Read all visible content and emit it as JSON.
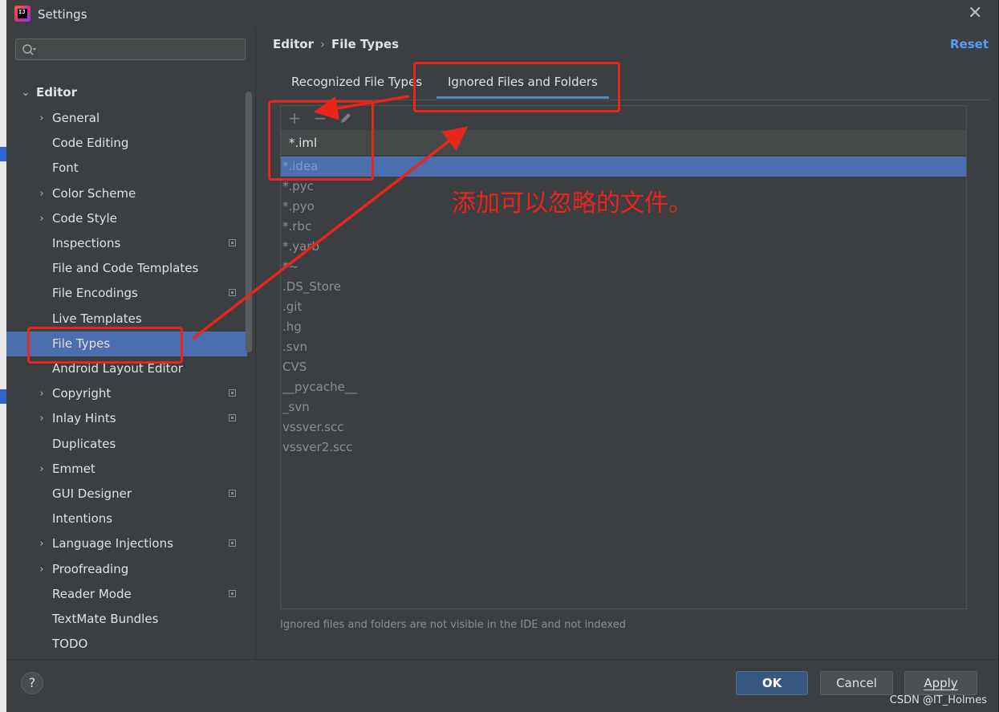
{
  "window": {
    "title": "Settings",
    "app_icon_text": "IJ"
  },
  "search": {
    "placeholder": "",
    "value": ""
  },
  "sidebar": {
    "section": {
      "label": "Editor",
      "expanded": true
    },
    "items": [
      {
        "label": "General",
        "has_children": true,
        "project_icon": false
      },
      {
        "label": "Code Editing",
        "has_children": false,
        "project_icon": false
      },
      {
        "label": "Font",
        "has_children": false,
        "project_icon": false
      },
      {
        "label": "Color Scheme",
        "has_children": true,
        "project_icon": false
      },
      {
        "label": "Code Style",
        "has_children": true,
        "project_icon": false
      },
      {
        "label": "Inspections",
        "has_children": false,
        "project_icon": true
      },
      {
        "label": "File and Code Templates",
        "has_children": false,
        "project_icon": false
      },
      {
        "label": "File Encodings",
        "has_children": false,
        "project_icon": true
      },
      {
        "label": "Live Templates",
        "has_children": false,
        "project_icon": false
      },
      {
        "label": "File Types",
        "has_children": false,
        "project_icon": false,
        "selected": true
      },
      {
        "label": "Android Layout Editor",
        "has_children": false,
        "project_icon": false
      },
      {
        "label": "Copyright",
        "has_children": true,
        "project_icon": true
      },
      {
        "label": "Inlay Hints",
        "has_children": true,
        "project_icon": true
      },
      {
        "label": "Duplicates",
        "has_children": false,
        "project_icon": false
      },
      {
        "label": "Emmet",
        "has_children": true,
        "project_icon": false
      },
      {
        "label": "GUI Designer",
        "has_children": false,
        "project_icon": true
      },
      {
        "label": "Intentions",
        "has_children": false,
        "project_icon": false
      },
      {
        "label": "Language Injections",
        "has_children": true,
        "project_icon": true
      },
      {
        "label": "Proofreading",
        "has_children": true,
        "project_icon": false
      },
      {
        "label": "Reader Mode",
        "has_children": false,
        "project_icon": true
      },
      {
        "label": "TextMate Bundles",
        "has_children": false,
        "project_icon": false
      },
      {
        "label": "TODO",
        "has_children": false,
        "project_icon": false
      }
    ]
  },
  "breadcrumb": {
    "parent": "Editor",
    "separator": "›",
    "current": "File Types"
  },
  "reset_label": "Reset",
  "tabs": [
    {
      "label": "Recognized File Types",
      "active": false
    },
    {
      "label": "Ignored Files and Folders",
      "active": true
    }
  ],
  "toolbar": {
    "add_icon": "plus-icon",
    "remove_icon": "minus-icon",
    "edit_icon": "pencil-icon"
  },
  "pattern_input": {
    "value": "*.iml"
  },
  "ignored_patterns": [
    {
      "text": "*.idea",
      "selected": true
    },
    {
      "text": "*.pyc"
    },
    {
      "text": "*.pyo"
    },
    {
      "text": "*.rbc"
    },
    {
      "text": "*.yarb"
    },
    {
      "text": "*~"
    },
    {
      "text": ".DS_Store"
    },
    {
      "text": ".git"
    },
    {
      "text": ".hg"
    },
    {
      "text": ".svn"
    },
    {
      "text": "CVS"
    },
    {
      "text": "__pycache__"
    },
    {
      "text": "_svn"
    },
    {
      "text": "vssver.scc"
    },
    {
      "text": "vssver2.scc"
    }
  ],
  "hint_text": "Ignored files and folders are not visible in the IDE and not indexed",
  "footer": {
    "help": "?",
    "ok": "OK",
    "cancel": "Cancel",
    "apply": "Apply"
  },
  "annotation": {
    "text": "添加可以忽略的文件。",
    "color": "#e8261c"
  },
  "watermark": "CSDN @IT_Holmes",
  "colors": {
    "accent": "#4b6eaf",
    "link": "#589df6",
    "annotation": "#e8261c",
    "ok_button": "#365880"
  }
}
